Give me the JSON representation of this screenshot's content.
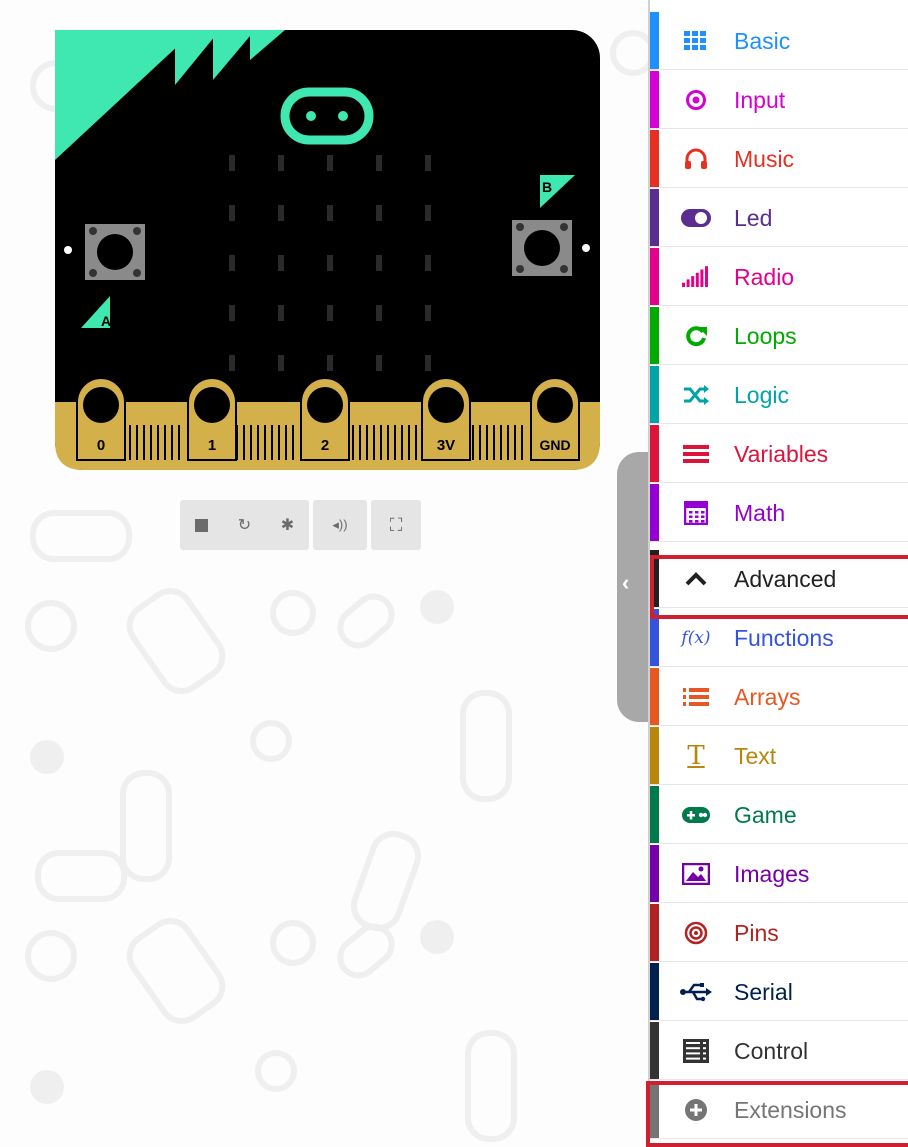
{
  "simulator": {
    "pins": [
      "0",
      "1",
      "2",
      "3V",
      "GND"
    ],
    "buttons": {
      "a": "A",
      "b": "B"
    },
    "toolbar": [
      {
        "icon": "stop-icon"
      },
      {
        "icon": "restart-icon"
      },
      {
        "icon": "debug-icon"
      },
      {
        "icon": "mute-icon"
      },
      {
        "icon": "fullscreen-icon"
      }
    ]
  },
  "toolbox": {
    "categories": [
      {
        "label": "Basic",
        "color": "#1e90ff",
        "icon": "grid-icon"
      },
      {
        "label": "Input",
        "color": "#d400d4",
        "icon": "target-icon"
      },
      {
        "label": "Music",
        "color": "#e63022",
        "icon": "headphones-icon"
      },
      {
        "label": "Led",
        "color": "#5c2d91",
        "icon": "toggle-icon"
      },
      {
        "label": "Radio",
        "color": "#e3008c",
        "icon": "signal-bars-icon"
      },
      {
        "label": "Loops",
        "color": "#00aa00",
        "icon": "refresh-icon"
      },
      {
        "label": "Logic",
        "color": "#00a4a6",
        "icon": "shuffle-icon"
      },
      {
        "label": "Variables",
        "color": "#dc143c",
        "icon": "list-icon"
      },
      {
        "label": "Math",
        "color": "#9400d3",
        "icon": "calculator-icon"
      },
      {
        "label": "Advanced",
        "color": "#212121",
        "icon": "chevron-up-icon"
      },
      {
        "label": "Functions",
        "color": "#3455db",
        "icon": "function-icon"
      },
      {
        "label": "Arrays",
        "color": "#e65722",
        "icon": "array-list-icon"
      },
      {
        "label": "Text",
        "color": "#b8860b",
        "icon": "text-icon"
      },
      {
        "label": "Game",
        "color": "#007a4b",
        "icon": "gamepad-icon"
      },
      {
        "label": "Images",
        "color": "#7600a8",
        "icon": "image-icon"
      },
      {
        "label": "Pins",
        "color": "#b22222",
        "icon": "bullseye-icon"
      },
      {
        "label": "Serial",
        "color": "#002050",
        "icon": "usb-icon"
      },
      {
        "label": "Control",
        "color": "#333333",
        "icon": "server-icon"
      },
      {
        "label": "Extensions",
        "color": "#757575",
        "icon": "plus-circle-icon"
      }
    ]
  }
}
